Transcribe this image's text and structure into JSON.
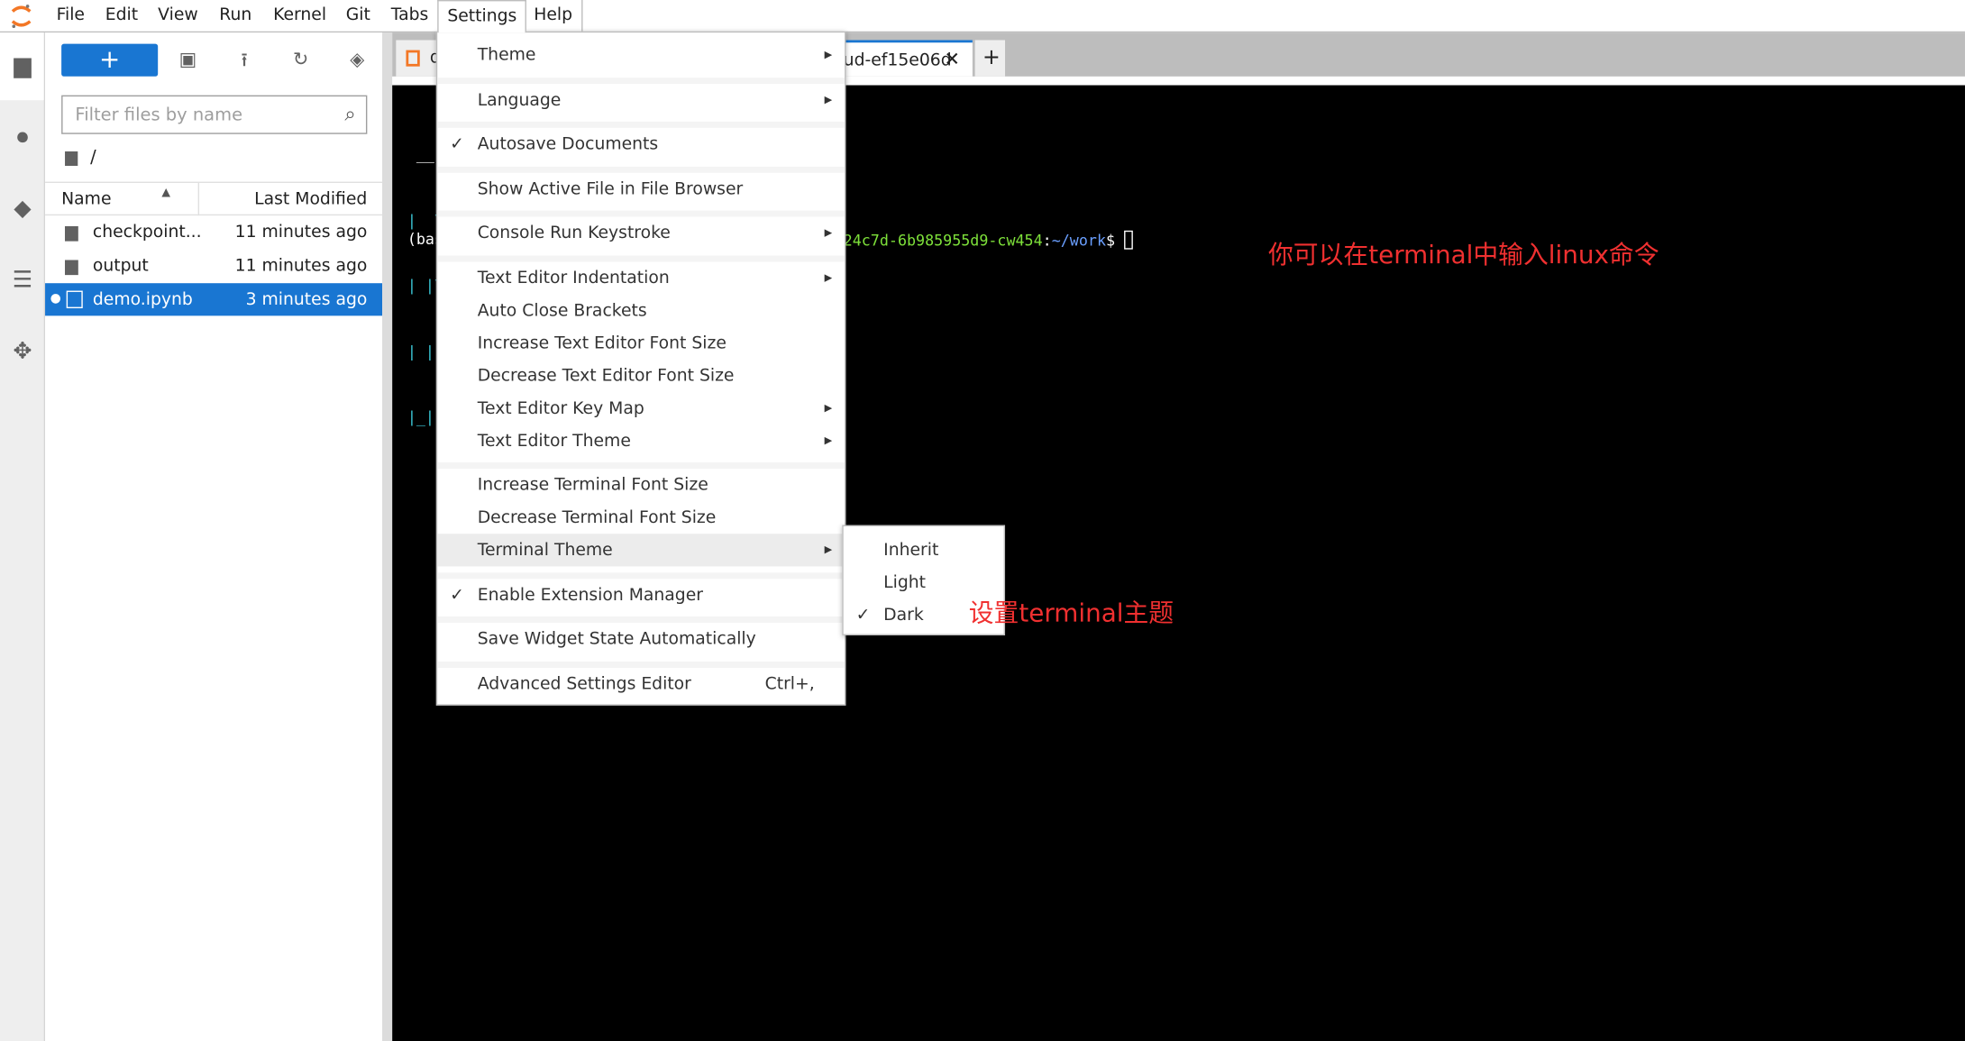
{
  "menubar": {
    "items": [
      "File",
      "Edit",
      "View",
      "Run",
      "Kernel",
      "Git",
      "Tabs",
      "Settings",
      "Help"
    ],
    "active": "Settings"
  },
  "filebrowser": {
    "new_label": "+",
    "filter_placeholder": "Filter files by name",
    "path": "/",
    "col_name": "Name",
    "col_modified": "Last Modified",
    "files": [
      {
        "name": "checkpoint...",
        "modified": "11 minutes ago",
        "type": "folder"
      },
      {
        "name": "output",
        "modified": "11 minutes ago",
        "type": "folder"
      },
      {
        "name": "demo.ipynb",
        "modified": "3 minutes ago",
        "type": "notebook",
        "selected": true
      }
    ]
  },
  "tabs": [
    {
      "label": "d"
    },
    {
      "label": "ud-ef15e06d",
      "active": true
    }
  ],
  "tab_add": "+",
  "terminal": {
    "banner": [
      " __",
      "|  \\",
      "| |\\",
      "| |",
      "|_|"
    ],
    "prompt_prefix": "(bas",
    "host": "24c7d-6b985955d9-cw454",
    "colon": ":",
    "path": "~/work",
    "dollar": "$"
  },
  "settings_menu": [
    {
      "label": "Theme",
      "submenu": true
    },
    {
      "label": "Language",
      "submenu": true,
      "sep": true
    },
    {
      "label": "Autosave Documents",
      "checked": true,
      "sep": true
    },
    {
      "label": "Show Active File in File Browser",
      "sep": true
    },
    {
      "label": "Console Run Keystroke",
      "submenu": true,
      "sep": true
    },
    {
      "label": "Text Editor Indentation",
      "submenu": true,
      "sep": true
    },
    {
      "label": "Auto Close Brackets"
    },
    {
      "label": "Increase Text Editor Font Size"
    },
    {
      "label": "Decrease Text Editor Font Size"
    },
    {
      "label": "Text Editor Key Map",
      "submenu": true
    },
    {
      "label": "Text Editor Theme",
      "submenu": true
    },
    {
      "label": "Increase Terminal Font Size",
      "sep": true
    },
    {
      "label": "Decrease Terminal Font Size"
    },
    {
      "label": "Terminal Theme",
      "submenu": true,
      "highlighted": true
    },
    {
      "label": "Enable Extension Manager",
      "checked": true,
      "sep": true
    },
    {
      "label": "Save Widget State Automatically",
      "sep": true
    },
    {
      "label": "Advanced Settings Editor",
      "shortcut": "Ctrl+,",
      "sep": true
    }
  ],
  "terminal_theme_submenu": [
    {
      "label": "Inherit"
    },
    {
      "label": "Light"
    },
    {
      "label": "Dark",
      "checked": true
    }
  ],
  "annotations": {
    "terminal_note": "你可以在terminal中输入linux命令",
    "theme_note": "设置terminal主题"
  },
  "colors": {
    "accent": "#1976d2",
    "annotation": "#f03030",
    "prompt_host": "#7ee13a",
    "prompt_path": "#6a9fff"
  }
}
